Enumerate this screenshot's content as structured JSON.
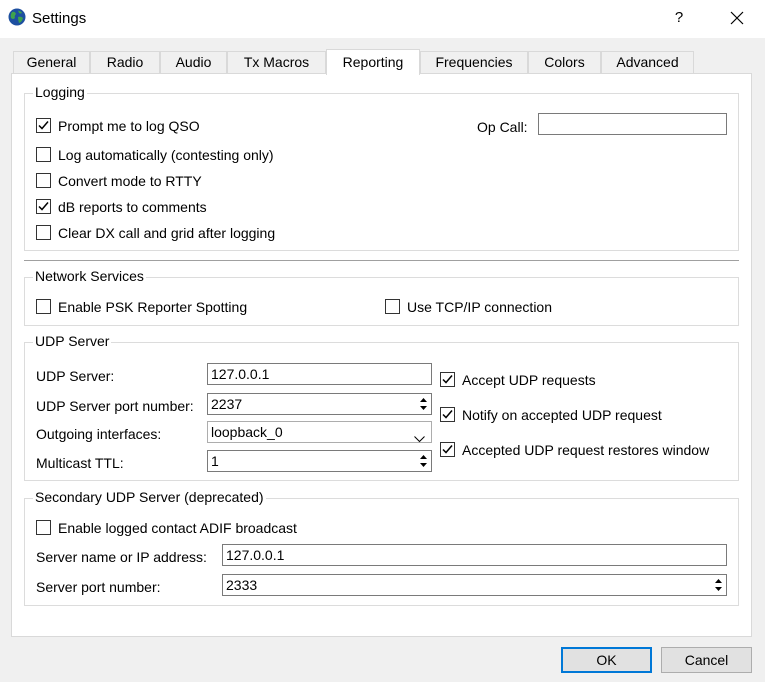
{
  "window": {
    "title": "Settings",
    "help": "?"
  },
  "tabs": [
    {
      "label": "General"
    },
    {
      "label": "Radio"
    },
    {
      "label": "Audio"
    },
    {
      "label": "Tx Macros"
    },
    {
      "label": "Reporting",
      "active": true
    },
    {
      "label": "Frequencies"
    },
    {
      "label": "Colors"
    },
    {
      "label": "Advanced"
    }
  ],
  "logging": {
    "title": "Logging",
    "options": [
      {
        "label": "Prompt me to log QSO",
        "checked": true
      },
      {
        "label": "Log automatically (contesting only)",
        "checked": false
      },
      {
        "label": "Convert mode to RTTY",
        "checked": false
      },
      {
        "label": "dB reports to comments",
        "checked": true
      },
      {
        "label": "Clear DX call and grid after logging",
        "checked": false
      }
    ],
    "op_call_label": "Op Call:",
    "op_call_value": ""
  },
  "network": {
    "title": "Network Services",
    "psk_label": "Enable PSK Reporter Spotting",
    "psk_checked": false,
    "tcp_label": "Use TCP/IP connection",
    "tcp_checked": false
  },
  "udp": {
    "title": "UDP Server",
    "server_label": "UDP Server:",
    "server_value": "127.0.0.1",
    "port_label": "UDP Server port number:",
    "port_value": "2237",
    "iface_label": "Outgoing interfaces:",
    "iface_value": "loopback_0",
    "ttl_label": "Multicast TTL:",
    "ttl_value": "1",
    "options": [
      {
        "label": "Accept UDP requests",
        "checked": true
      },
      {
        "label": "Notify on accepted UDP request",
        "checked": true
      },
      {
        "label": "Accepted UDP request restores window",
        "checked": true
      }
    ]
  },
  "secondary": {
    "title": "Secondary UDP Server (deprecated)",
    "adif_label": "Enable logged contact ADIF broadcast",
    "adif_checked": false,
    "host_label": "Server name or IP address:",
    "host_value": "127.0.0.1",
    "port_label": "Server port number:",
    "port_value": "2333"
  },
  "buttons": {
    "ok": "OK",
    "cancel": "Cancel"
  },
  "colors": {
    "accent": "#0078d7",
    "panel": "#ffffff",
    "window_bg": "#f0f0f0"
  }
}
